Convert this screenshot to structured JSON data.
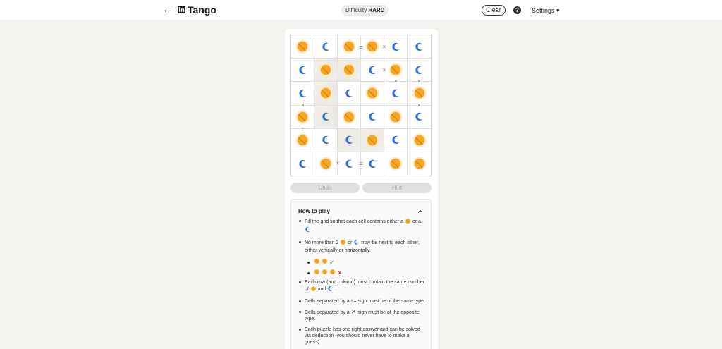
{
  "header": {
    "app_title": "Tango",
    "difficulty_label": "Difficulty",
    "difficulty_value": "HARD",
    "clear_label": "Clear",
    "help_icon": "?",
    "settings_label": "Settings"
  },
  "board": {
    "rows": [
      [
        "sun",
        "moon",
        "sun",
        "sun",
        "moon",
        "moon"
      ],
      [
        "moon",
        "sun",
        "sun",
        "moon",
        "sun",
        "moon"
      ],
      [
        "moon",
        "sun",
        "moon",
        "sun",
        "moon",
        "sun"
      ],
      [
        "sun",
        "moon",
        "sun",
        "moon",
        "sun",
        "moon"
      ],
      [
        "sun",
        "moon",
        "moon",
        "sun",
        "moon",
        "sun"
      ],
      [
        "moon",
        "sun",
        "moon",
        "moon",
        "sun",
        "sun"
      ]
    ],
    "locked": [
      [
        1,
        1
      ],
      [
        1,
        2
      ],
      [
        2,
        1
      ],
      [
        3,
        1
      ],
      [
        4,
        2
      ],
      [
        4,
        3
      ]
    ],
    "signs": [
      {
        "between": [
          [
            0,
            2
          ],
          [
            0,
            3
          ]
        ],
        "symbol": "="
      },
      {
        "between": [
          [
            0,
            3
          ],
          [
            0,
            4
          ]
        ],
        "symbol": "×"
      },
      {
        "between": [
          [
            1,
            3
          ],
          [
            1,
            4
          ]
        ],
        "symbol": "×"
      },
      {
        "between": [
          [
            1,
            4
          ],
          [
            2,
            4
          ]
        ],
        "symbol": "×"
      },
      {
        "between": [
          [
            1,
            5
          ],
          [
            2,
            5
          ]
        ],
        "symbol": "×"
      },
      {
        "between": [
          [
            2,
            0
          ],
          [
            3,
            0
          ]
        ],
        "symbol": "×"
      },
      {
        "between": [
          [
            2,
            5
          ],
          [
            3,
            5
          ]
        ],
        "symbol": "×"
      },
      {
        "between": [
          [
            3,
            0
          ],
          [
            4,
            0
          ]
        ],
        "symbol": "="
      },
      {
        "between": [
          [
            5,
            1
          ],
          [
            5,
            2
          ]
        ],
        "symbol": "×"
      },
      {
        "between": [
          [
            5,
            2
          ],
          [
            5,
            3
          ]
        ],
        "symbol": "="
      }
    ],
    "accent_sun": "#f5a623",
    "accent_moon": "#2f6fe0"
  },
  "buttons": {
    "undo_label": "Undo",
    "hint_label": "Hint"
  },
  "how_to_play": {
    "title": "How to play",
    "r1_a": "Fill the grid so that each cell contains either a",
    "r1_b": "or",
    "r1_c": "a",
    "r1_d": ".",
    "r2_a": "No more than 2",
    "r2_b": "or",
    "r2_c": "may be next to each other, either vertically or horizontally.",
    "r3_a": "Each row (and column) must contain the same number of",
    "r3_b": "and",
    "r3_c": ".",
    "r4": "Cells separated by an = sign must be of the same type.",
    "r5_a": "Cells separated by a",
    "r5_x": "✕",
    "r5_b": "sign must be of the opposite type.",
    "r6": "Each puzzle has one right answer and can be solved via deduction (you should never have to make a guess)."
  }
}
